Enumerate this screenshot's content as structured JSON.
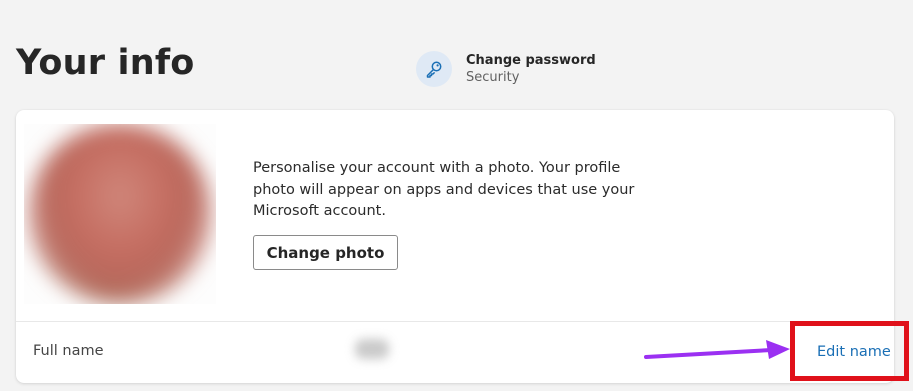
{
  "page": {
    "title": "Your info"
  },
  "security": {
    "title": "Change password",
    "subtitle": "Security",
    "icon": "key-icon"
  },
  "photo_section": {
    "description": "Personalise your account with a photo. Your profile photo will appear on apps and devices that use your Microsoft account.",
    "change_photo_label": "Change photo"
  },
  "name_section": {
    "label": "Full name",
    "edit_label": "Edit name"
  },
  "colors": {
    "accent_link": "#1a6fb5",
    "annotation_box": "#e0111a",
    "annotation_arrow": "#9b30f2",
    "key_badge_bg": "#dfe9f5"
  }
}
